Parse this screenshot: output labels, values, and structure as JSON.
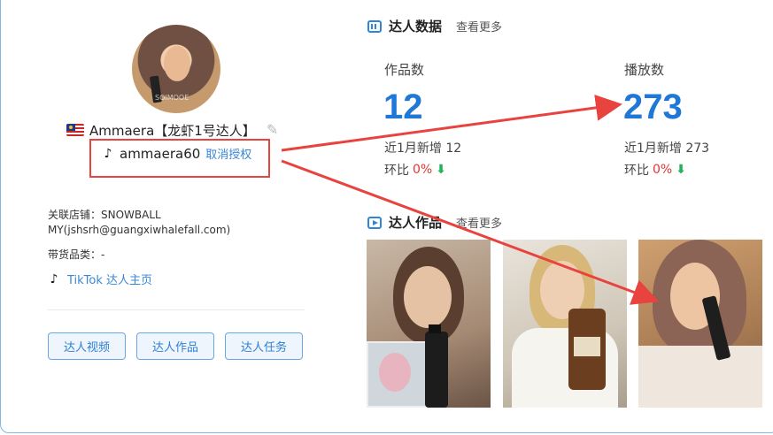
{
  "profile": {
    "name": "Ammaera【龙虾1号达人】",
    "handle": "ammaera60",
    "revoke_label": "取消授权",
    "avatar_watermark": "SOIMOOE",
    "shop_label": "关联店铺：SNOWBALL MY(jshsrh@guangxiwhalefall.com)",
    "category_label": "带货品类：-",
    "tiktok_link": "TikTok 达人主页",
    "buttons": [
      "达人视频",
      "达人作品",
      "达人任务"
    ]
  },
  "data_section": {
    "title": "达人数据",
    "more": "查看更多",
    "works": {
      "label": "作品数",
      "value": "12",
      "recent": "近1月新增 12",
      "ratio_label": "环比",
      "ratio_value": "0%"
    },
    "plays": {
      "label": "播放数",
      "value": "273",
      "recent": "近1月新增 273",
      "ratio_label": "环比",
      "ratio_value": "0%"
    }
  },
  "works_section": {
    "title": "达人作品",
    "more": "查看更多"
  },
  "colors": {
    "accent": "#1f78d6",
    "annotation_red": "#e8433f",
    "down_green": "#27b05a",
    "ratio_red": "#e03636"
  }
}
